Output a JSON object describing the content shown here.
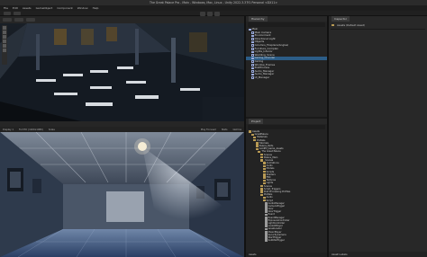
{
  "window": {
    "title": "The Great Palace Pro - Main - Windows, Mac, Linux - Unity 2022.3.37f1 Personal <DX11>"
  },
  "menu": [
    "File",
    "Edit",
    "Assets",
    "GameObject",
    "Component",
    "Window",
    "Help"
  ],
  "scene": {
    "tab_label": "Scene",
    "tool_icons": [
      "hand-tool-icon",
      "move-tool-icon",
      "rotate-tool-icon",
      "scale-tool-icon",
      "rect-tool-icon",
      "transform-tool-icon"
    ]
  },
  "game": {
    "tab_label": "Game",
    "display": "Display 1",
    "aspect": "Full HD (1920x1080)",
    "scale": "Scale",
    "play_focused": "Play Focused",
    "stats": "Stats",
    "gizmos": "Gizmos"
  },
  "hierarchy": {
    "tab_label": "Hierarchy",
    "search_placeholder": "All",
    "items": [
      {
        "label": "Main",
        "depth": 0,
        "selected": false
      },
      {
        "label": "Main Camera",
        "depth": 1,
        "selected": false
      },
      {
        "label": "Environment",
        "depth": 1,
        "selected": false
      },
      {
        "label": "Directional Light",
        "depth": 1,
        "selected": false
      },
      {
        "label": "Objects",
        "depth": 1,
        "selected": false
      },
      {
        "label": "Columns_Fireplace(Angles)",
        "depth": 1,
        "selected": false
      },
      {
        "label": "Furniture_Complex",
        "depth": 1,
        "selected": false
      },
      {
        "label": "Lights_Interior",
        "depth": 1,
        "selected": false
      },
      {
        "label": "Wedding_Scene",
        "depth": 1,
        "selected": false
      },
      {
        "label": "Ceiling_Chandel",
        "depth": 1,
        "selected": true
      },
      {
        "label": "Ceiling",
        "depth": 1,
        "selected": false
      },
      {
        "label": "Window_Frames",
        "depth": 1,
        "selected": false
      },
      {
        "label": "PostProcess",
        "depth": 1,
        "selected": false
      },
      {
        "label": "Audio_Manager",
        "depth": 1,
        "selected": false
      },
      {
        "label": "Audio_Manager",
        "depth": 1,
        "selected": false
      },
      {
        "label": "UI_Manager",
        "depth": 1,
        "selected": false
      }
    ]
  },
  "inspector": {
    "tab_label": "Inspector",
    "header": "Assets (Default Asset)"
  },
  "project": {
    "tab_label": "Project",
    "items": [
      {
        "label": "Assets",
        "depth": 0,
        "kind": "folder"
      },
      {
        "label": "GreatPalace",
        "depth": 1,
        "kind": "folder"
      },
      {
        "label": "Materials",
        "depth": 2,
        "kind": "folder"
      },
      {
        "label": "Prefabs",
        "depth": 2,
        "kind": "folder"
      },
      {
        "label": "Tutorials",
        "depth": 3,
        "kind": "folder"
      },
      {
        "label": "Palace_Parts",
        "depth": 3,
        "kind": "folder"
      },
      {
        "label": "Goldfill_Game_Assets",
        "depth": 3,
        "kind": "folder"
      },
      {
        "label": "The Great Palace",
        "depth": 4,
        "kind": "folder"
      },
      {
        "label": "Scenes",
        "depth": 5,
        "kind": "folder"
      },
      {
        "label": "Palace_Main",
        "depth": 5,
        "kind": "folder"
      },
      {
        "label": "_Scenes",
        "depth": 5,
        "kind": "folder"
      },
      {
        "label": "Animations",
        "depth": 6,
        "kind": "folder"
      },
      {
        "label": "Audio",
        "depth": 6,
        "kind": "folder"
      },
      {
        "label": "Models",
        "depth": 6,
        "kind": "folder"
      },
      {
        "label": "Scripts",
        "depth": 6,
        "kind": "folder"
      },
      {
        "label": "Shaders",
        "depth": 6,
        "kind": "folder"
      },
      {
        "label": "FBX",
        "depth": 6,
        "kind": "folder"
      },
      {
        "label": "Textures",
        "depth": 6,
        "kind": "folder"
      },
      {
        "label": "Lights",
        "depth": 6,
        "kind": "folder"
      },
      {
        "label": "Scenes",
        "depth": 5,
        "kind": "folder"
      },
      {
        "label": "Script_Triggers",
        "depth": 5,
        "kind": "folder"
      },
      {
        "label": "Post Processing Profiles",
        "depth": 5,
        "kind": "folder"
      },
      {
        "label": "Prefabs",
        "depth": 5,
        "kind": "folder"
      },
      {
        "label": "Audio",
        "depth": 6,
        "kind": "folder"
      },
      {
        "label": "Script",
        "depth": 6,
        "kind": "folder"
      },
      {
        "label": "AudioManager",
        "depth": 7,
        "kind": "file"
      },
      {
        "label": "CameraTrigger",
        "depth": 7,
        "kind": "file"
      },
      {
        "label": "Door",
        "depth": 7,
        "kind": "file"
      },
      {
        "label": "DoorTrigger",
        "depth": 7,
        "kind": "file"
      },
      {
        "label": "Event",
        "depth": 7,
        "kind": "file"
      },
      {
        "label": "EventManager",
        "depth": 7,
        "kind": "file"
      },
      {
        "label": "ExposureController",
        "depth": 7,
        "kind": "file"
      },
      {
        "label": "LightController",
        "depth": 7,
        "kind": "file"
      },
      {
        "label": "LookAtPlayer",
        "depth": 7,
        "kind": "file"
      },
      {
        "label": "LevelLoader",
        "depth": 7,
        "kind": "file"
      },
      {
        "label": "MusicPlayer",
        "depth": 7,
        "kind": "file"
      },
      {
        "label": "SecurityCamera",
        "depth": 7,
        "kind": "file"
      },
      {
        "label": "StartTrigger",
        "depth": 7,
        "kind": "file"
      },
      {
        "label": "SubtitleTrigger",
        "depth": 7,
        "kind": "file"
      }
    ],
    "footer": "Assets"
  },
  "asset_labels": "Asset Labels",
  "colors": {
    "selection": "#2c5d87",
    "panel": "#232323"
  }
}
